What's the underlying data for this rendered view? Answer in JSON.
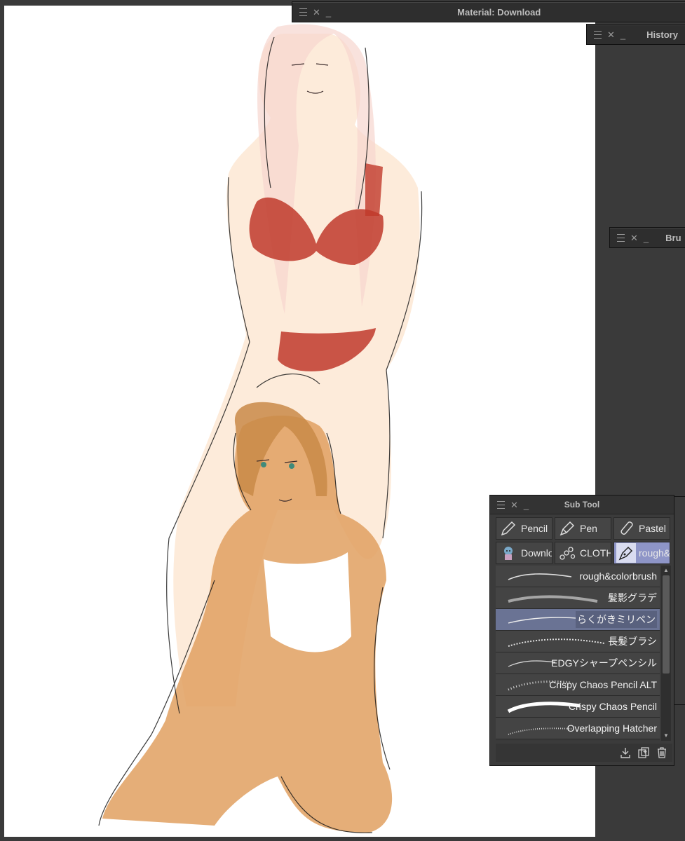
{
  "panels": {
    "material": {
      "title": "Material: Download"
    },
    "history": {
      "title": "History"
    },
    "brush": {
      "title": "Bru"
    },
    "subtool": {
      "title": "Sub Tool"
    }
  },
  "subtool_groups": [
    {
      "label": "Pencil",
      "icon": "pencil-icon"
    },
    {
      "label": "Pen",
      "icon": "pen-icon"
    },
    {
      "label": "Pastel",
      "icon": "pastel-icon"
    },
    {
      "label": "Downlo",
      "icon": "character-icon"
    },
    {
      "label": "CLOTH",
      "icon": "chain-icon"
    },
    {
      "label": "rough&",
      "icon": "pen-nib-icon",
      "selected": true
    }
  ],
  "brushes": [
    {
      "name": "rough&colorbrush"
    },
    {
      "name": "髪影グラデ"
    },
    {
      "name": "らくがきミリペン",
      "selected": true
    },
    {
      "name": "長髪ブラシ"
    },
    {
      "name": "EDGYシャープペンシル"
    },
    {
      "name": "Crispy Chaos Pencil ALT"
    },
    {
      "name": "Crispy Chaos Pencil"
    },
    {
      "name": "Overlapping Hatcher"
    }
  ],
  "icons": {
    "menu": "hamburger-icon",
    "close": "close-icon",
    "minimize": "minimize-icon",
    "close_glyph": "✕",
    "minimize_glyph": "_",
    "footer": [
      "import-icon",
      "duplicate-icon",
      "trash-icon"
    ]
  }
}
